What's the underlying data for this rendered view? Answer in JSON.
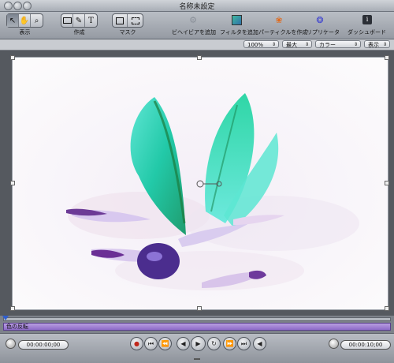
{
  "window": {
    "title": "名称未設定"
  },
  "toolbar": {
    "group_labels": {
      "view": "表示",
      "create": "作成",
      "mask": "マスク"
    },
    "actions": {
      "add_behavior": "ビヘイビアを追加",
      "add_filter": "フィルタを追加",
      "create_particles": "パーティクルを作成",
      "replicator": "リプリケータ",
      "dashboard": "ダッシュボード"
    }
  },
  "view_options": {
    "zoom": "100%",
    "resolution": "最大",
    "channel": "カラー",
    "display": "表示"
  },
  "timeline": {
    "track_label": "色の反転"
  },
  "transport": {
    "current_time": "00:00:00;00",
    "duration": "00:00:10;00"
  },
  "colors": {
    "track": "#9a7fd6",
    "accent": "#2fe0c8"
  }
}
